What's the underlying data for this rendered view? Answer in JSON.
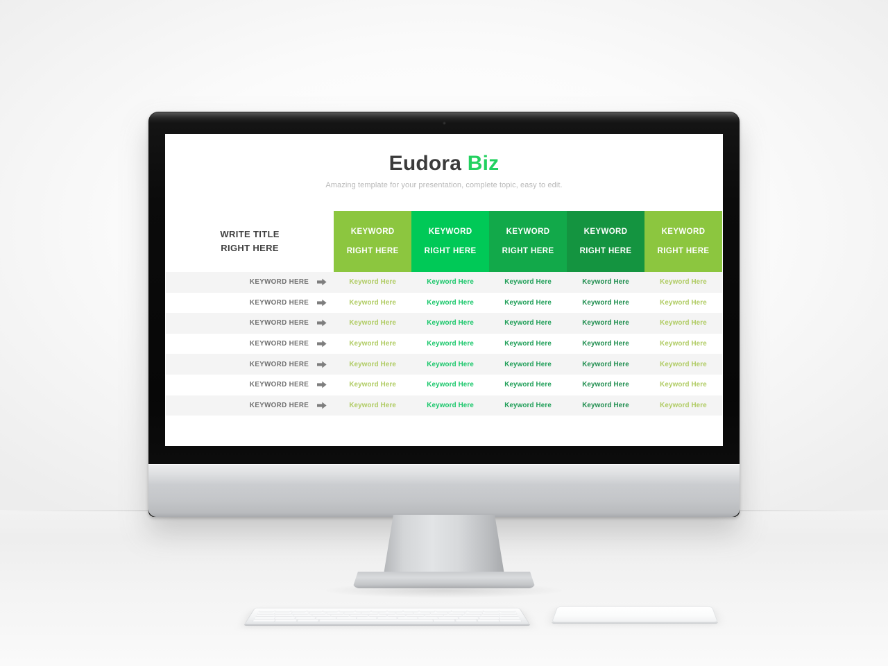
{
  "slide": {
    "title_main": "Eudora ",
    "title_accent": "Biz",
    "subtitle": "Amazing template for your presentation, complete topic, easy to edit.",
    "table": {
      "corner_title_line1": "WRITE TITLE",
      "corner_title_line2": "RIGHT HERE",
      "headers": [
        {
          "line1": "KEYWORD",
          "line2": "RIGHT HERE",
          "bg": "#8CC63F"
        },
        {
          "line1": "KEYWORD",
          "line2": "RIGHT HERE",
          "bg": "#00C957"
        },
        {
          "line1": "KEYWORD",
          "line2": "RIGHT HERE",
          "bg": "#12A94A"
        },
        {
          "line1": "KEYWORD",
          "line2": "RIGHT HERE",
          "bg": "#149440"
        },
        {
          "line1": "KEYWORD",
          "line2": "RIGHT HERE",
          "bg": "#8CC63F"
        }
      ],
      "column_text_colors": [
        "#AFCB62",
        "#19C76A",
        "#1E9E57",
        "#1C8C4C",
        "#AFCB62"
      ],
      "row_label": "KEYWORD HERE",
      "row_icon": "arrow-right-icon",
      "cell_text": "Keyword Here",
      "rows": [
        {
          "label": "KEYWORD HERE",
          "cells": [
            "Keyword Here",
            "Keyword Here",
            "Keyword Here",
            "Keyword Here",
            "Keyword Here"
          ]
        },
        {
          "label": "KEYWORD HERE",
          "cells": [
            "Keyword Here",
            "Keyword Here",
            "Keyword Here",
            "Keyword Here",
            "Keyword Here"
          ]
        },
        {
          "label": "KEYWORD HERE",
          "cells": [
            "Keyword Here",
            "Keyword Here",
            "Keyword Here",
            "Keyword Here",
            "Keyword Here"
          ]
        },
        {
          "label": "KEYWORD HERE",
          "cells": [
            "Keyword Here",
            "Keyword Here",
            "Keyword Here",
            "Keyword Here",
            "Keyword Here"
          ]
        },
        {
          "label": "KEYWORD HERE",
          "cells": [
            "Keyword Here",
            "Keyword Here",
            "Keyword Here",
            "Keyword Here",
            "Keyword Here"
          ]
        },
        {
          "label": "KEYWORD HERE",
          "cells": [
            "Keyword Here",
            "Keyword Here",
            "Keyword Here",
            "Keyword Here",
            "Keyword Here"
          ]
        },
        {
          "label": "KEYWORD HERE",
          "cells": [
            "Keyword Here",
            "Keyword Here",
            "Keyword Here",
            "Keyword Here",
            "Keyword Here"
          ]
        }
      ]
    }
  },
  "hardware": {
    "monitor": "desktop-monitor",
    "webcam": "webcam-icon",
    "keyboard": "keyboard",
    "trackpad": "trackpad"
  },
  "colors": {
    "accent_green": "#22d15f",
    "title_gray": "#3b3b3b",
    "subtitle_gray": "#b9b9b9",
    "row_stripe": "#f4f4f4",
    "row_plain": "#ffffff"
  }
}
